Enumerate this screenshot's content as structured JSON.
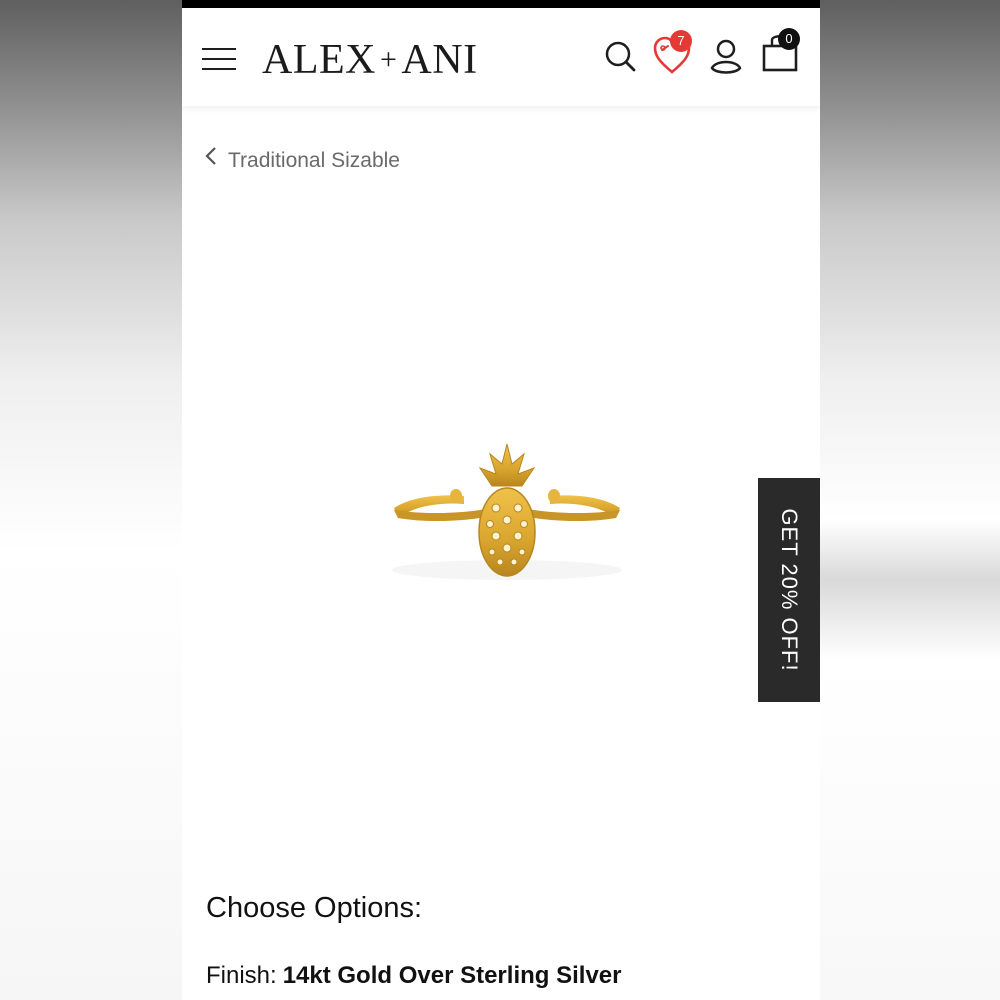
{
  "header": {
    "brand_left": "ALEX",
    "brand_sep": "+",
    "brand_right": "ANI",
    "wishlist_count": "7",
    "cart_count": "0"
  },
  "breadcrumb": {
    "label": "Traditional Sizable"
  },
  "promo": {
    "label": "GET 20% OFF!"
  },
  "options": {
    "title": "Choose Options:",
    "finish_label": "Finish:",
    "finish_value": "14kt Gold Over Sterling Silver"
  },
  "icons": {
    "menu": "hamburger-icon",
    "search": "search-icon",
    "wishlist": "heart-tag-icon",
    "account": "user-icon",
    "cart": "shopping-bag-icon",
    "back": "chevron-left-icon"
  },
  "colors": {
    "badge_wishlist": "#e53935",
    "badge_cart": "#111111",
    "heart": "#e53935",
    "promo_bg": "#2a2a2a",
    "gold": "#d9a52e"
  }
}
